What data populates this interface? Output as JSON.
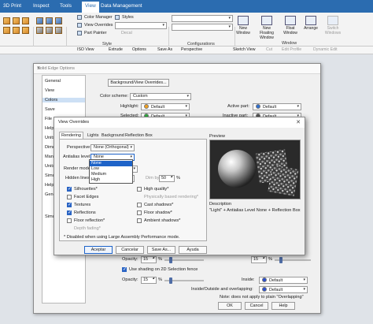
{
  "ribbon": {
    "menu": [
      "3D Print",
      "Inspect",
      "Tools",
      "View",
      "Data Management"
    ],
    "style_items": [
      "Color Manager",
      "View Overrides",
      "Part Painter"
    ],
    "styles_label": "Styles",
    "decal_label": "Decal",
    "group_style": "Style",
    "group_configurations": "Configurations",
    "group_window": "Window",
    "window_buttons": [
      "New Window",
      "New Floating Window",
      "Float Window",
      "Arrange",
      "Switch Windows"
    ]
  },
  "quickbar": [
    "ISO View",
    "Extrude",
    "Options",
    "Save As",
    "Perspective",
    "Sketch View",
    "Cut",
    "Edit Profile",
    "Dynamic Edit"
  ],
  "solid_edge_options": {
    "title": "Solid Edge Options",
    "categories": [
      "General",
      "View",
      "Colors",
      "Save",
      "File L",
      "Helpe",
      "Units",
      "Dime",
      "Manu",
      "Units",
      "Simulation",
      "Helpe",
      "Gene",
      "Simu"
    ],
    "selected_category": "Colors",
    "bg_override_button": "Background/View Overrides...",
    "color_scheme_label": "Color scheme:",
    "color_scheme_value": "Custom",
    "left_colors": [
      {
        "label": "Highlight:",
        "value": "Default",
        "color": "#f0a020"
      },
      {
        "label": "Selected:",
        "value": "Default",
        "color": "#30b040"
      }
    ],
    "right_colors": [
      {
        "label": "Active part:",
        "value": "Default",
        "color": "#3070d0"
      },
      {
        "label": "Inactive part:",
        "value": "Default",
        "color": "#555555"
      }
    ],
    "opacity_label": "Opacity:",
    "opacity_value_1": "15",
    "opacity_value_2": "15",
    "opacity_value_3": "15",
    "pct": "%",
    "shading_checkbox": "Use shading on 2D Selection fence",
    "inside_label": "Inside:",
    "inside_value": "Default",
    "inside_color": "#2a4fd0",
    "overlap_label": "Inside/Outside and overlapping:",
    "overlap_value": "Default",
    "overlap_color": "#2a4fd0",
    "note": "Note: does not apply to plain \"Overlapping\"",
    "buttons": [
      "OK",
      "Cancel",
      "Help"
    ]
  },
  "view_overrides": {
    "title": "View Overrides",
    "tabs": [
      "Rendering",
      "Lights",
      "Background",
      "Reflection Box"
    ],
    "active_tab": "Rendering",
    "perspective_label": "Perspective:",
    "perspective_value": "None (Orthogonal)",
    "antialias_label": "Antialias level:",
    "antialias_value": "None",
    "antialias_options": [
      "None",
      "Low",
      "Medium",
      "High"
    ],
    "antialias_highlighted": "None",
    "render_mode_label": "Render mode:",
    "hidden_lines_label": "Hidden lines:",
    "dim_by_label": "Dim by:",
    "dim_by_value": "50",
    "checks_left": [
      {
        "label": "Silhouettes*",
        "checked": true,
        "enabled": true
      },
      {
        "label": "Facet Edges",
        "checked": false,
        "enabled": true
      },
      {
        "label": "Textures",
        "checked": true,
        "enabled": true
      },
      {
        "label": "Reflections",
        "checked": true,
        "enabled": true
      },
      {
        "label": "Floor reflection*",
        "checked": false,
        "enabled": true
      },
      {
        "label": "Depth fading*",
        "checked": false,
        "enabled": false
      }
    ],
    "checks_right": [
      {
        "label": "High quality*",
        "checked": false,
        "enabled": true
      },
      {
        "label": "Physically based rendering*",
        "checked": false,
        "enabled": false
      },
      {
        "label": "Cast shadows*",
        "checked": false,
        "enabled": true
      },
      {
        "label": "Floor shadow*",
        "checked": false,
        "enabled": true
      },
      {
        "label": "Ambient shadows*",
        "checked": false,
        "enabled": true
      }
    ],
    "footnote": "* Disabled when using Large Assembly Performance mode.",
    "preview_label": "Preview",
    "description_label": "Description",
    "description_text": "\"Light\" + Antialias Level None + Reflection Box",
    "buttons": [
      "Aceptar",
      "Cancelar",
      "Save As...",
      "Ayuda"
    ]
  }
}
